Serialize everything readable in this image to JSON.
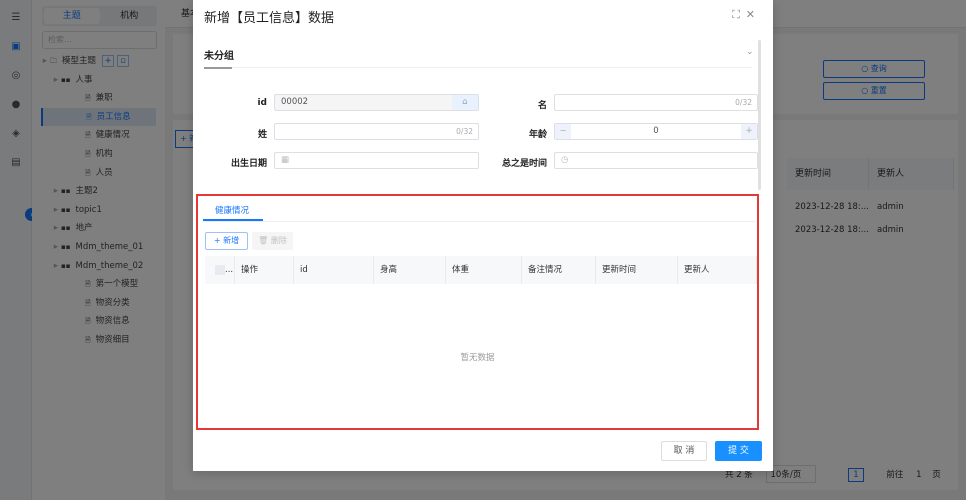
{
  "rail": {
    "icons": [
      "database-icon",
      "model-icon",
      "shield-icon",
      "settings-icon",
      "security-icon",
      "document-icon"
    ]
  },
  "tree": {
    "tabs": [
      "主题",
      "机构"
    ],
    "search_placeholder": "检索...",
    "nodes": [
      {
        "label": "模型主题",
        "level": 0,
        "icon": "folder-icon"
      },
      {
        "label": "人事",
        "level": 1,
        "icon": "grid-icon"
      },
      {
        "label": "兼职",
        "level": 2,
        "icon": "file-icon"
      },
      {
        "label": "员工信息",
        "level": 2,
        "icon": "file-icon",
        "selected": true
      },
      {
        "label": "健康情况",
        "level": 2,
        "icon": "file-icon"
      },
      {
        "label": "机构",
        "level": 2,
        "icon": "file-icon"
      },
      {
        "label": "人员",
        "level": 2,
        "icon": "file-icon"
      },
      {
        "label": "主题2",
        "level": 1,
        "icon": "grid-icon"
      },
      {
        "label": "topic1",
        "level": 1,
        "icon": "grid-icon"
      },
      {
        "label": "地产",
        "level": 1,
        "icon": "grid-icon"
      },
      {
        "label": "Mdm_theme_01",
        "level": 1,
        "icon": "grid-icon"
      },
      {
        "label": "Mdm_theme_02",
        "level": 1,
        "icon": "grid-icon"
      },
      {
        "label": "第一个模型",
        "level": 2,
        "icon": "file-icon"
      },
      {
        "label": "物资分类",
        "level": 2,
        "icon": "file-icon"
      },
      {
        "label": "物资信息",
        "level": 2,
        "icon": "file-icon"
      },
      {
        "label": "物资细目",
        "level": 2,
        "icon": "file-icon"
      }
    ]
  },
  "background": {
    "tab": "基本",
    "query_label": "查询",
    "reset_label": "重置",
    "add_label": "+ 新",
    "columns": [
      "更新时间",
      "更新人"
    ],
    "rows": [
      [
        "2023-12-28 18:...",
        "admin"
      ],
      [
        "2023-12-28 18:...",
        "admin"
      ]
    ],
    "pagination": {
      "total": "共 2 条",
      "page_size": "10条/页",
      "current": "1",
      "goto_label": "前往",
      "goto_value": "1",
      "page_suffix": "页"
    }
  },
  "modal": {
    "title": "新增【员工信息】数据",
    "group": "未分组",
    "fields": {
      "id": {
        "label": "id",
        "value": "00002"
      },
      "ming": {
        "label": "名",
        "counter": "0/32"
      },
      "xing": {
        "label": "姓",
        "counter": "0/32"
      },
      "age": {
        "label": "年龄",
        "value": "0",
        "minus": "−",
        "plus": "+"
      },
      "birth": {
        "label": "出生日期"
      },
      "time": {
        "label": "总之是时间"
      }
    },
    "subtable": {
      "tab": "健康情况",
      "add_label": "+ 新增",
      "delete_label": "删除",
      "columns": [
        "...",
        "操作",
        "id",
        "身高",
        "体重",
        "备注情况",
        "更新时间",
        "更新人"
      ],
      "empty_text": "暂无数据"
    },
    "cancel_label": "取 消",
    "submit_label": "提 交"
  }
}
